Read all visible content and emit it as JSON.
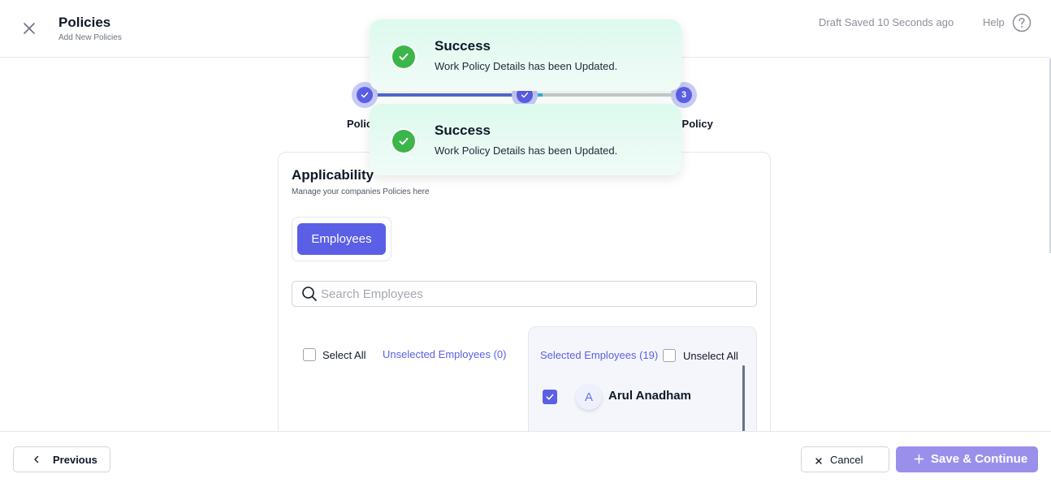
{
  "header": {
    "title": "Policies",
    "subtitle": "Add New Policies",
    "draft_status": "Draft Saved 10 Seconds ago",
    "help_label": "Help"
  },
  "stepper": {
    "steps": [
      {
        "number": "1",
        "label": "Polic",
        "state": "completed"
      },
      {
        "number": "2",
        "label": "",
        "state": "completed"
      },
      {
        "number": "3",
        "label": "n Policy",
        "state": "current"
      }
    ]
  },
  "toasts": [
    {
      "title": "Success",
      "message": "Work Policy Details has been Updated."
    },
    {
      "title": "Success",
      "message": "Work Policy Details has been Updated."
    }
  ],
  "card": {
    "title": "Applicability",
    "subtitle": "Manage your companies Policies here",
    "tab_label": "Employees",
    "search_placeholder": "Search Employees",
    "select_all_label": "Select All",
    "unselected_header": "Unselected Employees (0)",
    "selected_header": "Selected Employees (19)",
    "unselect_all_label": "Unselect All",
    "selected_employees": [
      {
        "initial": "A",
        "name": "Arul Anadham",
        "checked": true
      }
    ]
  },
  "footer": {
    "previous_label": "Previous",
    "cancel_label": "Cancel",
    "save_label": "Save & Continue"
  },
  "colors": {
    "accent": "#5b5fe6",
    "success": "#3cb54a",
    "save_button": "#9a90ec"
  }
}
